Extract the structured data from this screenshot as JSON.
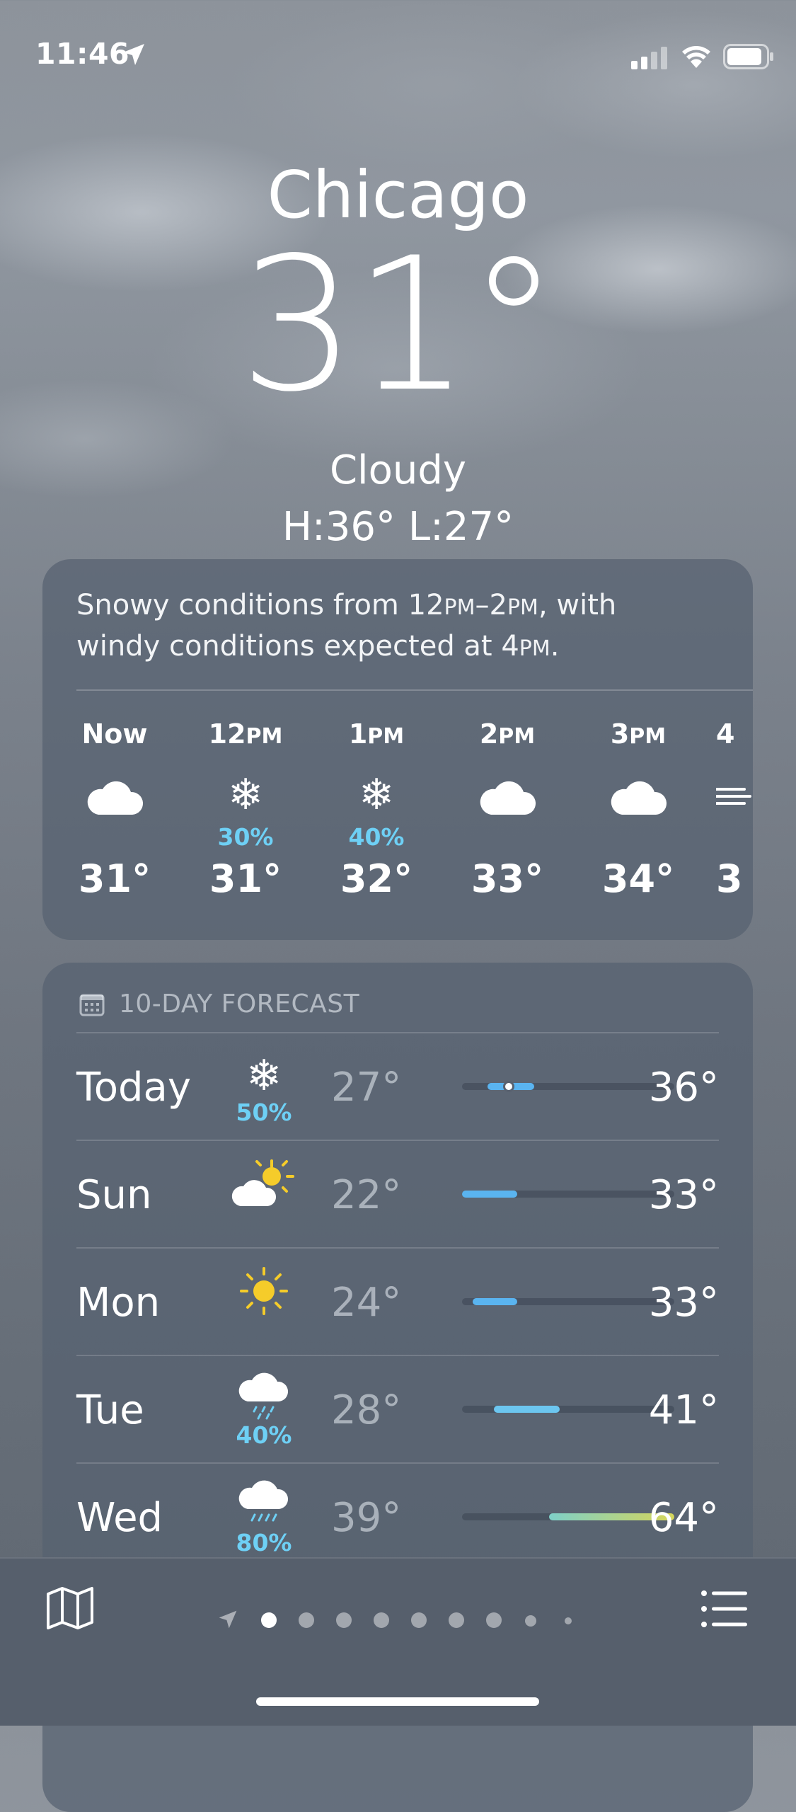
{
  "status_bar": {
    "time": "11:46"
  },
  "header": {
    "city": "Chicago",
    "temperature": "31°",
    "condition": "Cloudy",
    "high_low": "H:36°  L:27°"
  },
  "summary": {
    "line1_pre": "Snowy conditions from 12",
    "line1_pm1": "PM",
    "line1_mid": "–2",
    "line1_pm2": "PM",
    "line1_post": ", with",
    "line2_pre": "windy conditions expected at 4",
    "line2_pm": "PM",
    "line2_post": "."
  },
  "hourly": [
    {
      "num": "Now",
      "suffix": "",
      "icon": "cloud-icon",
      "precip": "",
      "temp": "31°"
    },
    {
      "num": "12",
      "suffix": "PM",
      "icon": "snowflake-icon",
      "precip": "30%",
      "temp": "31°"
    },
    {
      "num": "1",
      "suffix": "PM",
      "icon": "snowflake-icon",
      "precip": "40%",
      "temp": "32°"
    },
    {
      "num": "2",
      "suffix": "PM",
      "icon": "cloud-icon",
      "precip": "",
      "temp": "33°"
    },
    {
      "num": "3",
      "suffix": "PM",
      "icon": "cloud-icon",
      "precip": "",
      "temp": "34°"
    },
    {
      "num": "4",
      "suffix": "",
      "icon": "wind-icon",
      "precip": "",
      "temp": "3"
    }
  ],
  "daily": {
    "title": "10-DAY FORECAST",
    "days": [
      {
        "day": "Today",
        "icon": "snowflake-icon",
        "precip": "50%",
        "low": "27°",
        "high": "36°",
        "bar_start": 0.12,
        "bar_end": 0.34,
        "current": 0.22,
        "bar_color": "#5ab4f0"
      },
      {
        "day": "Sun",
        "icon": "partly-sunny-icon",
        "precip": "",
        "low": "22°",
        "high": "33°",
        "bar_start": 0.0,
        "bar_end": 0.26,
        "bar_color": "#5ab4f0"
      },
      {
        "day": "Mon",
        "icon": "sun-icon",
        "precip": "",
        "low": "24°",
        "high": "33°",
        "bar_start": 0.05,
        "bar_end": 0.26,
        "bar_color": "#5ab4f0"
      },
      {
        "day": "Tue",
        "icon": "rain-cloud-icon",
        "precip": "40%",
        "low": "28°",
        "high": "41°",
        "bar_start": 0.15,
        "bar_end": 0.46,
        "bar_color": "#6cc6f0"
      },
      {
        "day": "Wed",
        "icon": "rain-cloud-icon",
        "precip": "80%",
        "low": "39°",
        "high": "64°",
        "bar_start": 0.41,
        "bar_end": 1.0,
        "bar_color": "linear-gradient(90deg,#7ed0c8,#d6d65a)"
      }
    ]
  },
  "colors": {
    "precip": "#6ed0f5",
    "sun": "#f5cc2a"
  }
}
